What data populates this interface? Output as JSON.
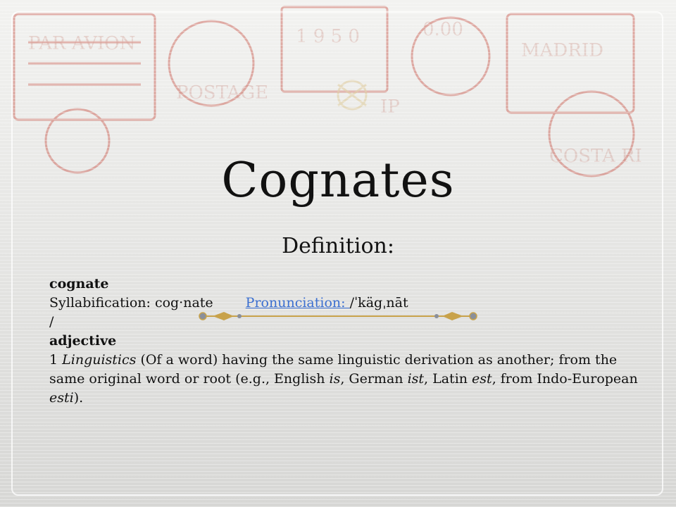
{
  "slide": {
    "title": "Cognates",
    "subtitle": "Definition:",
    "entry": {
      "headword": "cognate",
      "syllabification_label": "Syllabification: cog·nate",
      "pronunciation_label": "Pronunciation: ",
      "pronunciation_value": "/ˈkägˌnāt",
      "slash": "/",
      "part_of_speech": "adjective",
      "sense_number": "1 ",
      "domain": "Linguistics",
      "definition_a": " (Of a word) having the same linguistic derivation as another; from the same original word or root (e.g., English ",
      "ex1": "is",
      "sep1": ", German ",
      "ex2": "ist",
      "sep2": ", Latin ",
      "ex3": "est",
      "sep3": ", from Indo-European ",
      "ex4": "esti",
      "end": ")."
    },
    "colors": {
      "link": "#3b6fd0",
      "divider_gold": "#c8a24a",
      "stamp_red": "#c0392b"
    }
  }
}
